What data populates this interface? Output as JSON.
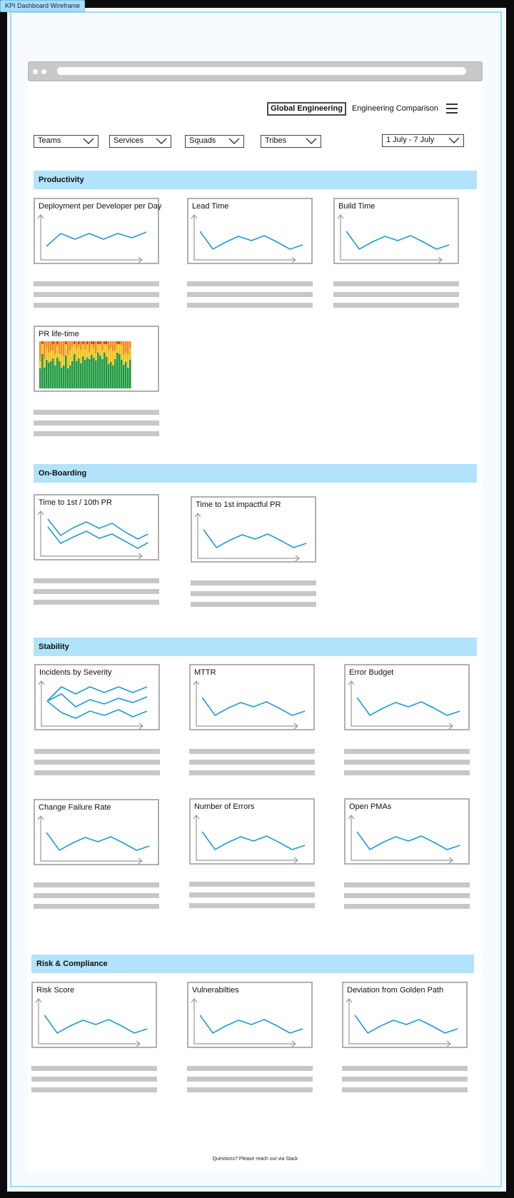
{
  "frame_label": "KPI Dashboard Wireframe",
  "header": {
    "active_tab": "Global Engineering",
    "tab": "Engineering Comparison",
    "menu_icon": "hamburger-icon"
  },
  "filters": {
    "teams": "Teams",
    "services": "Services",
    "squads": "Squads",
    "tribes": "Tribes",
    "date_range": "1 July - 7 July"
  },
  "sections": {
    "productivity": {
      "title": "Productivity",
      "cards": [
        "Deployment per Developer per Day",
        "Lead Time",
        "Build Time",
        "PR life-time"
      ]
    },
    "onboarding": {
      "title": "On-Boarding",
      "cards": [
        "Time to 1st / 10th PR",
        "Time to 1st impactful PR"
      ]
    },
    "stability": {
      "title": "Stability",
      "cards": [
        "Incidents by Severity",
        "MTTR",
        "Error Budget",
        "Change Failure Rate",
        "Number of Errors",
        "Open PMAs"
      ]
    },
    "risk": {
      "title": "Risk & Compliance",
      "cards": [
        "Risk Score",
        "Vulnerabilties",
        "Deviation from Golden Path"
      ]
    }
  },
  "footer": "Questions? Please reach out via Slack",
  "colors": {
    "frame_border": "#9fdcf8",
    "section_header": "#b2e3fb",
    "chart_line": "#1e9bd7",
    "axis": "#9a9a9a",
    "placeholder": "#c7c7c7",
    "heatmap_green": "#1f9a3f",
    "heatmap_yellow": "#f4c21b",
    "heatmap_orange": "#f08c1e",
    "heatmap_red": "#e0352a"
  }
}
